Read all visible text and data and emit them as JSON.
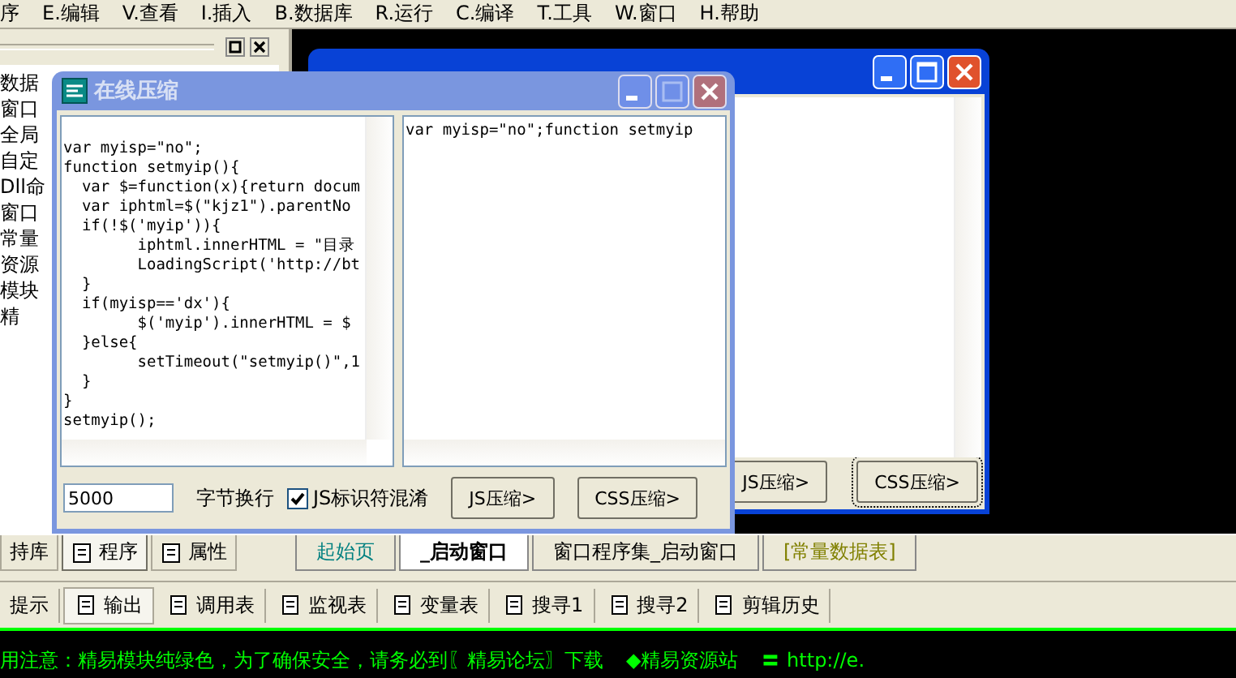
{
  "menu": [
    "序",
    "E.编辑",
    "V.查看",
    "I.插入",
    "B.数据库",
    "R.运行",
    "C.编译",
    "T.工具",
    "W.窗口",
    "H.帮助"
  ],
  "left_panel": {
    "items": [
      {
        "label": "数据"
      },
      {
        "label": "窗口"
      },
      {
        "label": "全局"
      },
      {
        "label": "自定"
      },
      {
        "label": "Dll命"
      },
      {
        "label": "窗口"
      },
      {
        "label": "常量"
      },
      {
        "label": "资源"
      },
      {
        "label": "模块"
      },
      {
        "label": "精"
      }
    ]
  },
  "back_window": {
    "buttons": [
      "JS压缩>",
      "CSS压缩>"
    ]
  },
  "front_window": {
    "title": "在线压缩",
    "source_code": [
      "var myisp=\"no\";",
      "function setmyip(){",
      "  var $=function(x){return docum",
      "  var iphtml=$(\"kjz1\").parentNo",
      "  if(!$('myip')){",
      "        iphtml.innerHTML = \"目录",
      "        LoadingScript('http://bt",
      "  }",
      "  if(myisp=='dx'){",
      "        $('myip').innerHTML = $",
      "  }else{",
      "        setTimeout(\"setmyip()\",1",
      "  }",
      "}",
      "setmyip();"
    ],
    "output_text": "var myisp=\"no\";function setmyip",
    "line_bytes": "5000",
    "line_bytes_label": "字节换行",
    "obfuscate": {
      "label": "JS标识符混淆",
      "checked": true
    },
    "buttons": [
      "JS压缩>",
      "CSS压缩>"
    ]
  },
  "panel_tabs": [
    {
      "label": "持库",
      "selected": false
    },
    {
      "label": "程序",
      "selected": true
    },
    {
      "label": "属性",
      "selected": false
    }
  ],
  "doc_tabs": [
    {
      "label": "起始页",
      "selected": false,
      "color": "#008080"
    },
    {
      "label": "_启动窗口",
      "selected": true,
      "color": "#000000"
    },
    {
      "label": "窗口程序集_启动窗口",
      "selected": false,
      "color": "#000000"
    },
    {
      "label": "[常量数据表]",
      "selected": false,
      "color": "#808000"
    }
  ],
  "bottom_tabs": [
    {
      "label": "提示",
      "selected": false
    },
    {
      "label": "输出",
      "selected": true
    },
    {
      "label": "调用表",
      "selected": false
    },
    {
      "label": "监视表",
      "selected": false
    },
    {
      "label": "变量表",
      "selected": false
    },
    {
      "label": "搜寻1",
      "selected": false
    },
    {
      "label": "搜寻2",
      "selected": false
    },
    {
      "label": "剪辑历史",
      "selected": false
    }
  ],
  "status": {
    "notice": "用注意：精易模块纯绿色，为了确保安全，请务必到〖精易论坛〗下载",
    "site": "◆精易资源站",
    "url": "〓 http://e."
  }
}
